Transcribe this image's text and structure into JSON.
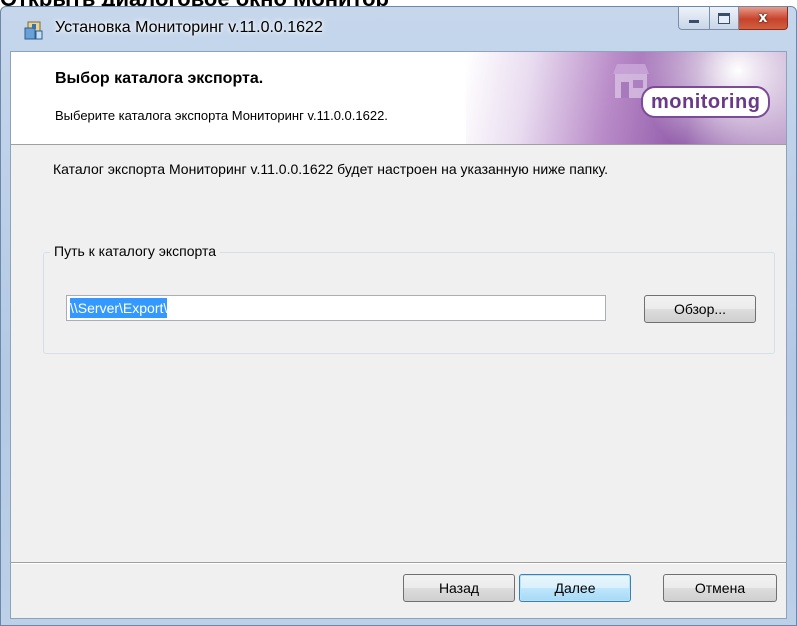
{
  "cropped_text": "Открыть диалоговое окно Монитор",
  "window": {
    "title": "Установка Мониторинг v.11.0.0.1622",
    "close_symbol": "x"
  },
  "banner": {
    "title": "Выбор каталога экспорта.",
    "subtitle": "Выберите каталога экспорта Мониторинг v.11.0.0.1622.",
    "logo_text": "monitoring"
  },
  "content": {
    "description": "Каталог экспорта Мониторинг v.11.0.0.1622 будет настроен на указанную ниже папку.",
    "group_label": "Путь к каталогу экспорта",
    "path_value": "\\\\Server\\Export\\",
    "browse_label": "Обзор..."
  },
  "footer": {
    "back_label": "Назад",
    "next_label": "Далее",
    "cancel_label": "Отмена"
  },
  "colors": {
    "accent": "#8f5aa8",
    "selection": "#3399ff",
    "window_frame": "#b3c9e4"
  },
  "icons": [
    "installer-app-icon",
    "minimize-icon",
    "maximize-icon",
    "close-icon",
    "store-icon",
    "monitoring-logo"
  ]
}
